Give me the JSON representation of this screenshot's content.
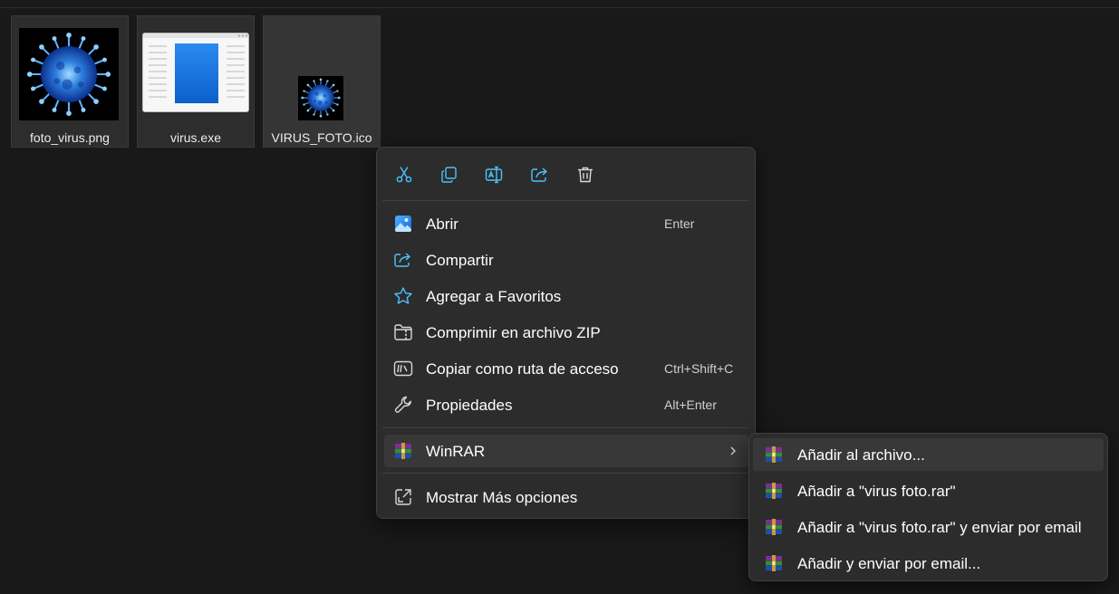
{
  "files": [
    {
      "name": "foto_virus.png",
      "thumbnail": "virus-image"
    },
    {
      "name": "virus.exe",
      "thumbnail": "executable-window"
    },
    {
      "name": "VIRUS_FOTO.ico",
      "thumbnail": "virus-icon-small"
    }
  ],
  "context_menu": {
    "toolbar": [
      {
        "icon": "cut-icon"
      },
      {
        "icon": "copy-icon"
      },
      {
        "icon": "rename-icon"
      },
      {
        "icon": "share-icon"
      },
      {
        "icon": "delete-icon"
      }
    ],
    "items": [
      {
        "label": "Abrir",
        "shortcut": "Enter",
        "icon": "photos-app-icon"
      },
      {
        "label": "Compartir",
        "shortcut": "",
        "icon": "share-icon"
      },
      {
        "label": "Agregar a Favoritos",
        "shortcut": "",
        "icon": "star-icon"
      },
      {
        "label": "Comprimir en archivo ZIP",
        "shortcut": "",
        "icon": "zip-folder-icon"
      },
      {
        "label": "Copiar como ruta de acceso",
        "shortcut": "Ctrl+Shift+C",
        "icon": "path-icon"
      },
      {
        "label": "Propiedades",
        "shortcut": "Alt+Enter",
        "icon": "wrench-icon"
      }
    ],
    "winrar": {
      "label": "WinRAR",
      "icon": "winrar-icon"
    },
    "more": {
      "label": "Mostrar Más opciones",
      "icon": "more-options-icon"
    }
  },
  "winrar_submenu": {
    "items": [
      {
        "label": "Añadir al archivo..."
      },
      {
        "label": "Añadir a \"virus foto.rar\""
      },
      {
        "label": "Añadir a \"virus foto.rar\" y enviar por email"
      },
      {
        "label": "Añadir y enviar por email..."
      }
    ]
  },
  "colors": {
    "background": "#191919",
    "menu_background": "#2c2c2c",
    "accent_blue": "#4cc2ff",
    "hover": "#383838"
  }
}
